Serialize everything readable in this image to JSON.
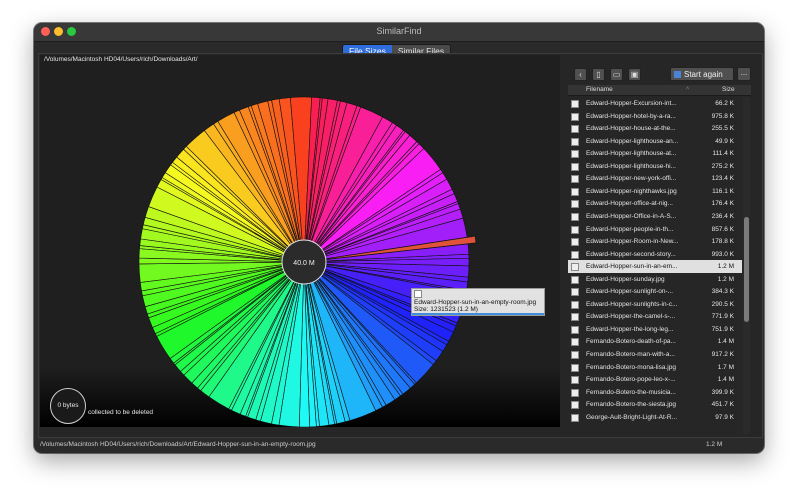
{
  "window": {
    "title": "SimilarFind"
  },
  "tabs": [
    {
      "label": "File Sizes",
      "active": true
    },
    {
      "label": "Similar Files",
      "active": false
    }
  ],
  "path": "/Volumes/Macintosh HD04/Users/rich/Downloads/Art/",
  "chart_data": {
    "type": "pie",
    "center_label": "40.0 M",
    "highlighted_slice_color": "#e0523a",
    "values_note": ""
  },
  "tooltip": {
    "filename": "Edward-Hopper-sun-in-an-empty-room.jpg",
    "size": "Size: 1231523 (1.2 M)"
  },
  "delete_bin": {
    "amount": "0 bytes",
    "label": "collected to be deleted"
  },
  "toolbar": {
    "back_icon": "chevron-left-icon",
    "start_label": "Start again",
    "more_label": "..."
  },
  "list": {
    "columns": [
      "Filename",
      "Size"
    ],
    "rows": [
      {
        "name": "Edward-Hopper-Excursion-int...",
        "size": "66.2 K"
      },
      {
        "name": "Edward-Hopper-hotel-by-a-ra...",
        "size": "975.8 K"
      },
      {
        "name": "Edward-Hopper-house-at-the...",
        "size": "255.5 K"
      },
      {
        "name": "Edward-Hopper-lighthouse-an...",
        "size": "49.9 K"
      },
      {
        "name": "Edward-Hopper-lighthouse-at...",
        "size": "111.4 K"
      },
      {
        "name": "Edward-Hopper-lighthouse-hi...",
        "size": "275.2 K"
      },
      {
        "name": "Edward-Hopper-new-york-offi...",
        "size": "123.4 K"
      },
      {
        "name": "Edward-Hopper-nighthawks.jpg",
        "size": "116.1 K"
      },
      {
        "name": "Edward-Hopper-office-at-nig...",
        "size": "176.4 K"
      },
      {
        "name": "Edward-Hopper-Office-in-A-S...",
        "size": "236.4 K"
      },
      {
        "name": "Edward-Hopper-people-in-th...",
        "size": "857.6 K"
      },
      {
        "name": "Edward-Hopper-Room-in-New...",
        "size": "178.8 K"
      },
      {
        "name": "Edward-Hopper-second-story...",
        "size": "993.0 K"
      },
      {
        "name": "Edward-Hopper-sun-in-an-em...",
        "size": "1.2 M",
        "selected": true
      },
      {
        "name": "Edward-Hopper-sunday.jpg",
        "size": "1.2 M"
      },
      {
        "name": "Edward-Hopper-sunlight-on-...",
        "size": "384.3 K"
      },
      {
        "name": "Edward-Hopper-sunlights-in-c...",
        "size": "290.5 K"
      },
      {
        "name": "Edward-Hopper-the-camel-s-...",
        "size": "771.9 K"
      },
      {
        "name": "Edward-Hopper-the-long-leg...",
        "size": "751.9 K"
      },
      {
        "name": "Fernando-Botero-death-of-pa...",
        "size": "1.4 M"
      },
      {
        "name": "Fernando-Botero-man-with-a...",
        "size": "917.2 K"
      },
      {
        "name": "Fernando-Botero-mona-lisa.jpg",
        "size": "1.7 M"
      },
      {
        "name": "Fernando-Botero-pope-leo-x-...",
        "size": "1.4 M"
      },
      {
        "name": "Fernando-Botero-the-musicia...",
        "size": "399.9 K"
      },
      {
        "name": "Fernando-Botero-the-siesta.jpg",
        "size": "451.7 K"
      },
      {
        "name": "George-Ault-Bright-Light-At-R...",
        "size": "97.9 K"
      }
    ]
  },
  "status": {
    "path": "/Volumes/Macintosh HD04/Users/rich/Downloads/Art/Edward-Hopper-sun-in-an-empty-room.jpg",
    "size": "1.2 M"
  }
}
